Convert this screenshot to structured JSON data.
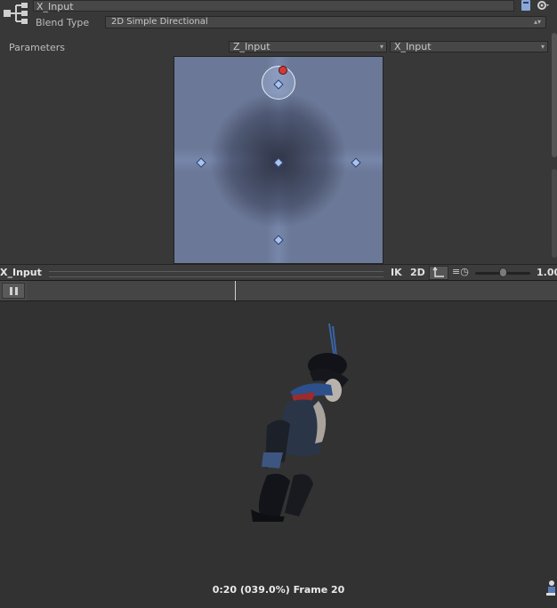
{
  "inspector": {
    "node_name": "X_Input",
    "blend_type_label": "Blend Type",
    "blend_type_value": "2D Simple Directional",
    "parameters_label": "Parameters",
    "param_y": "Z_Input",
    "param_x": "X_Input"
  },
  "blend_space": {
    "motions": [
      {
        "x": 0,
        "y": 1
      },
      {
        "x": -1,
        "y": 0
      },
      {
        "x": 0,
        "y": 0
      },
      {
        "x": 1,
        "y": 0
      },
      {
        "x": 0,
        "y": -1
      }
    ],
    "sample_position": {
      "x": 0,
      "y": 1
    }
  },
  "preview_toolbar": {
    "title": "X_Input",
    "ik_label": "IK",
    "twod_label": "2D",
    "speed_value": "1.00",
    "speed_fraction": 0.45
  },
  "timeline": {
    "playhead_fraction": 0.39
  },
  "viewport": {
    "time_readout": "0:20 (039.0%) Frame 20"
  },
  "colors": {
    "panel": "#383838",
    "blend_area": "#6b7897",
    "motion_point": "#a9c3f0",
    "sample_dot": "#d03a3a"
  },
  "icons": [
    "blend-tree-icon",
    "help-icon",
    "gear-icon",
    "pivot-icon",
    "speed-icon",
    "pause-icon"
  ]
}
